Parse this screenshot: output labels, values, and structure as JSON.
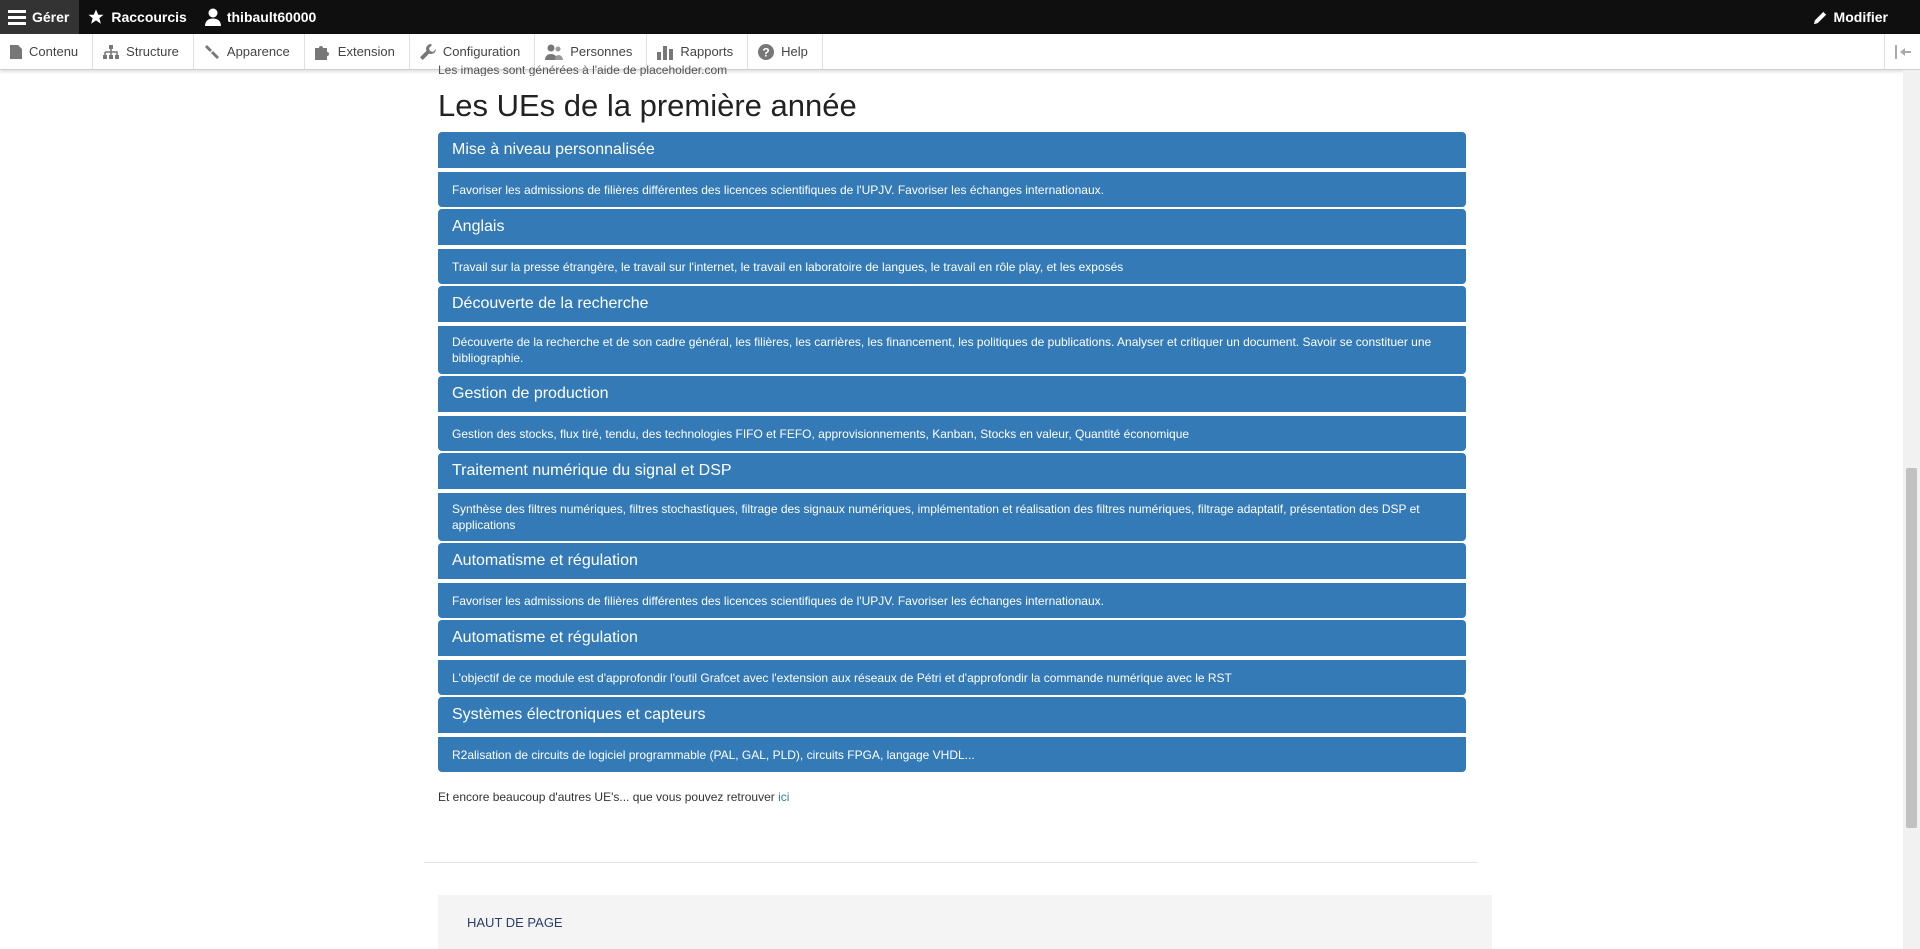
{
  "topbar": {
    "manage": "Gérer",
    "shortcuts": "Raccourcis",
    "user": "thibault60000",
    "edit": "Modifier"
  },
  "tray": {
    "items": [
      "Contenu",
      "Structure",
      "Apparence",
      "Extension",
      "Configuration",
      "Personnes",
      "Rapports",
      "Help"
    ]
  },
  "main": {
    "cut_text": "Les images sont générées à l'aide de placeholder.com",
    "heading": "Les UEs de la première année",
    "ues": [
      {
        "title": "Mise à niveau personnalisée",
        "desc": "Favoriser les admissions de filières différentes des licences scientifiques de l'UPJV. Favoriser les échanges internationaux."
      },
      {
        "title": "Anglais",
        "desc": "Travail sur la presse étrangère, le travail sur l'internet, le travail en laboratoire de langues, le travail en rôle play, et les exposés"
      },
      {
        "title": "Découverte de la recherche",
        "desc": "Découverte de la recherche et de son cadre général, les filières, les carrières, les financement, les politiques de publications. Analyser et critiquer un document. Savoir se constituer une bibliographie."
      },
      {
        "title": "Gestion de production",
        "desc": "Gestion des stocks, flux tiré, tendu, des technologies FIFO et FEFO, approvisionnements, Kanban, Stocks en valeur, Quantité économique"
      },
      {
        "title": "Traitement numérique du signal et DSP",
        "desc": "Synthèse des filtres numériques, filtres stochastiques, filtrage des signaux numériques, implémentation et réalisation des filtres numériques, filtrage adaptatif, présentation des DSP et applications"
      },
      {
        "title": "Automatisme et régulation",
        "desc": "Favoriser les admissions de filières différentes des licences scientifiques de l'UPJV. Favoriser les échanges internationaux."
      },
      {
        "title": "Automatisme et régulation",
        "desc": "L'objectif de ce module est d'approfondir l'outil Grafcet avec l'extension aux réseaux de Pétri et d'approfondir la commande numérique avec le RST"
      },
      {
        "title": "Systèmes électroniques et capteurs",
        "desc": "R2alisation de circuits de logiciel programmable (PAL, GAL, PLD), circuits FPGA, langage VHDL..."
      }
    ],
    "footer_text": "Et encore beaucoup d'autres UE's... que vous pouvez retrouver ",
    "footer_link": "ici"
  },
  "back_to_top": "HAUT DE PAGE",
  "colors": {
    "accent": "#337ab7",
    "topbar": "#0f0f0f"
  }
}
